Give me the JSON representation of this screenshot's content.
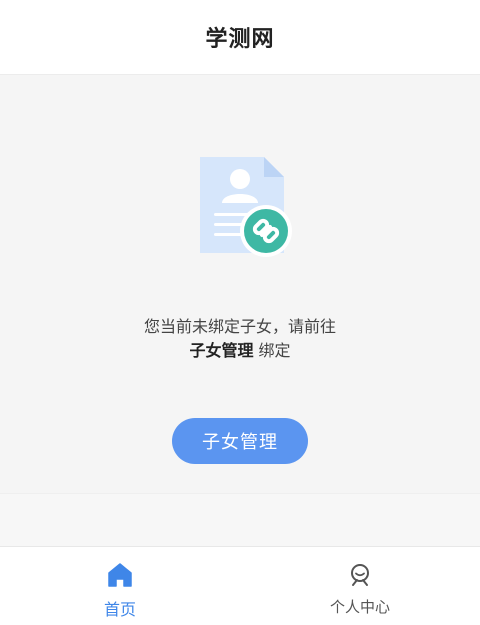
{
  "header": {
    "title": "学测网"
  },
  "empty_state": {
    "message_line1": "您当前未绑定子女，请前往",
    "message_strong": "子女管理",
    "message_suffix": " 绑定",
    "button_label": "子女管理",
    "illustration_icon": "document-link-icon"
  },
  "colors": {
    "accent": "#5b95f0",
    "tab_active": "#3f86e8",
    "link_badge": "#3eb8a4",
    "background": "#f5f5f5"
  },
  "tabbar": {
    "items": [
      {
        "label": "首页",
        "icon": "home-icon",
        "active": true
      },
      {
        "label": "个人中心",
        "icon": "profile-icon",
        "active": false
      }
    ]
  }
}
